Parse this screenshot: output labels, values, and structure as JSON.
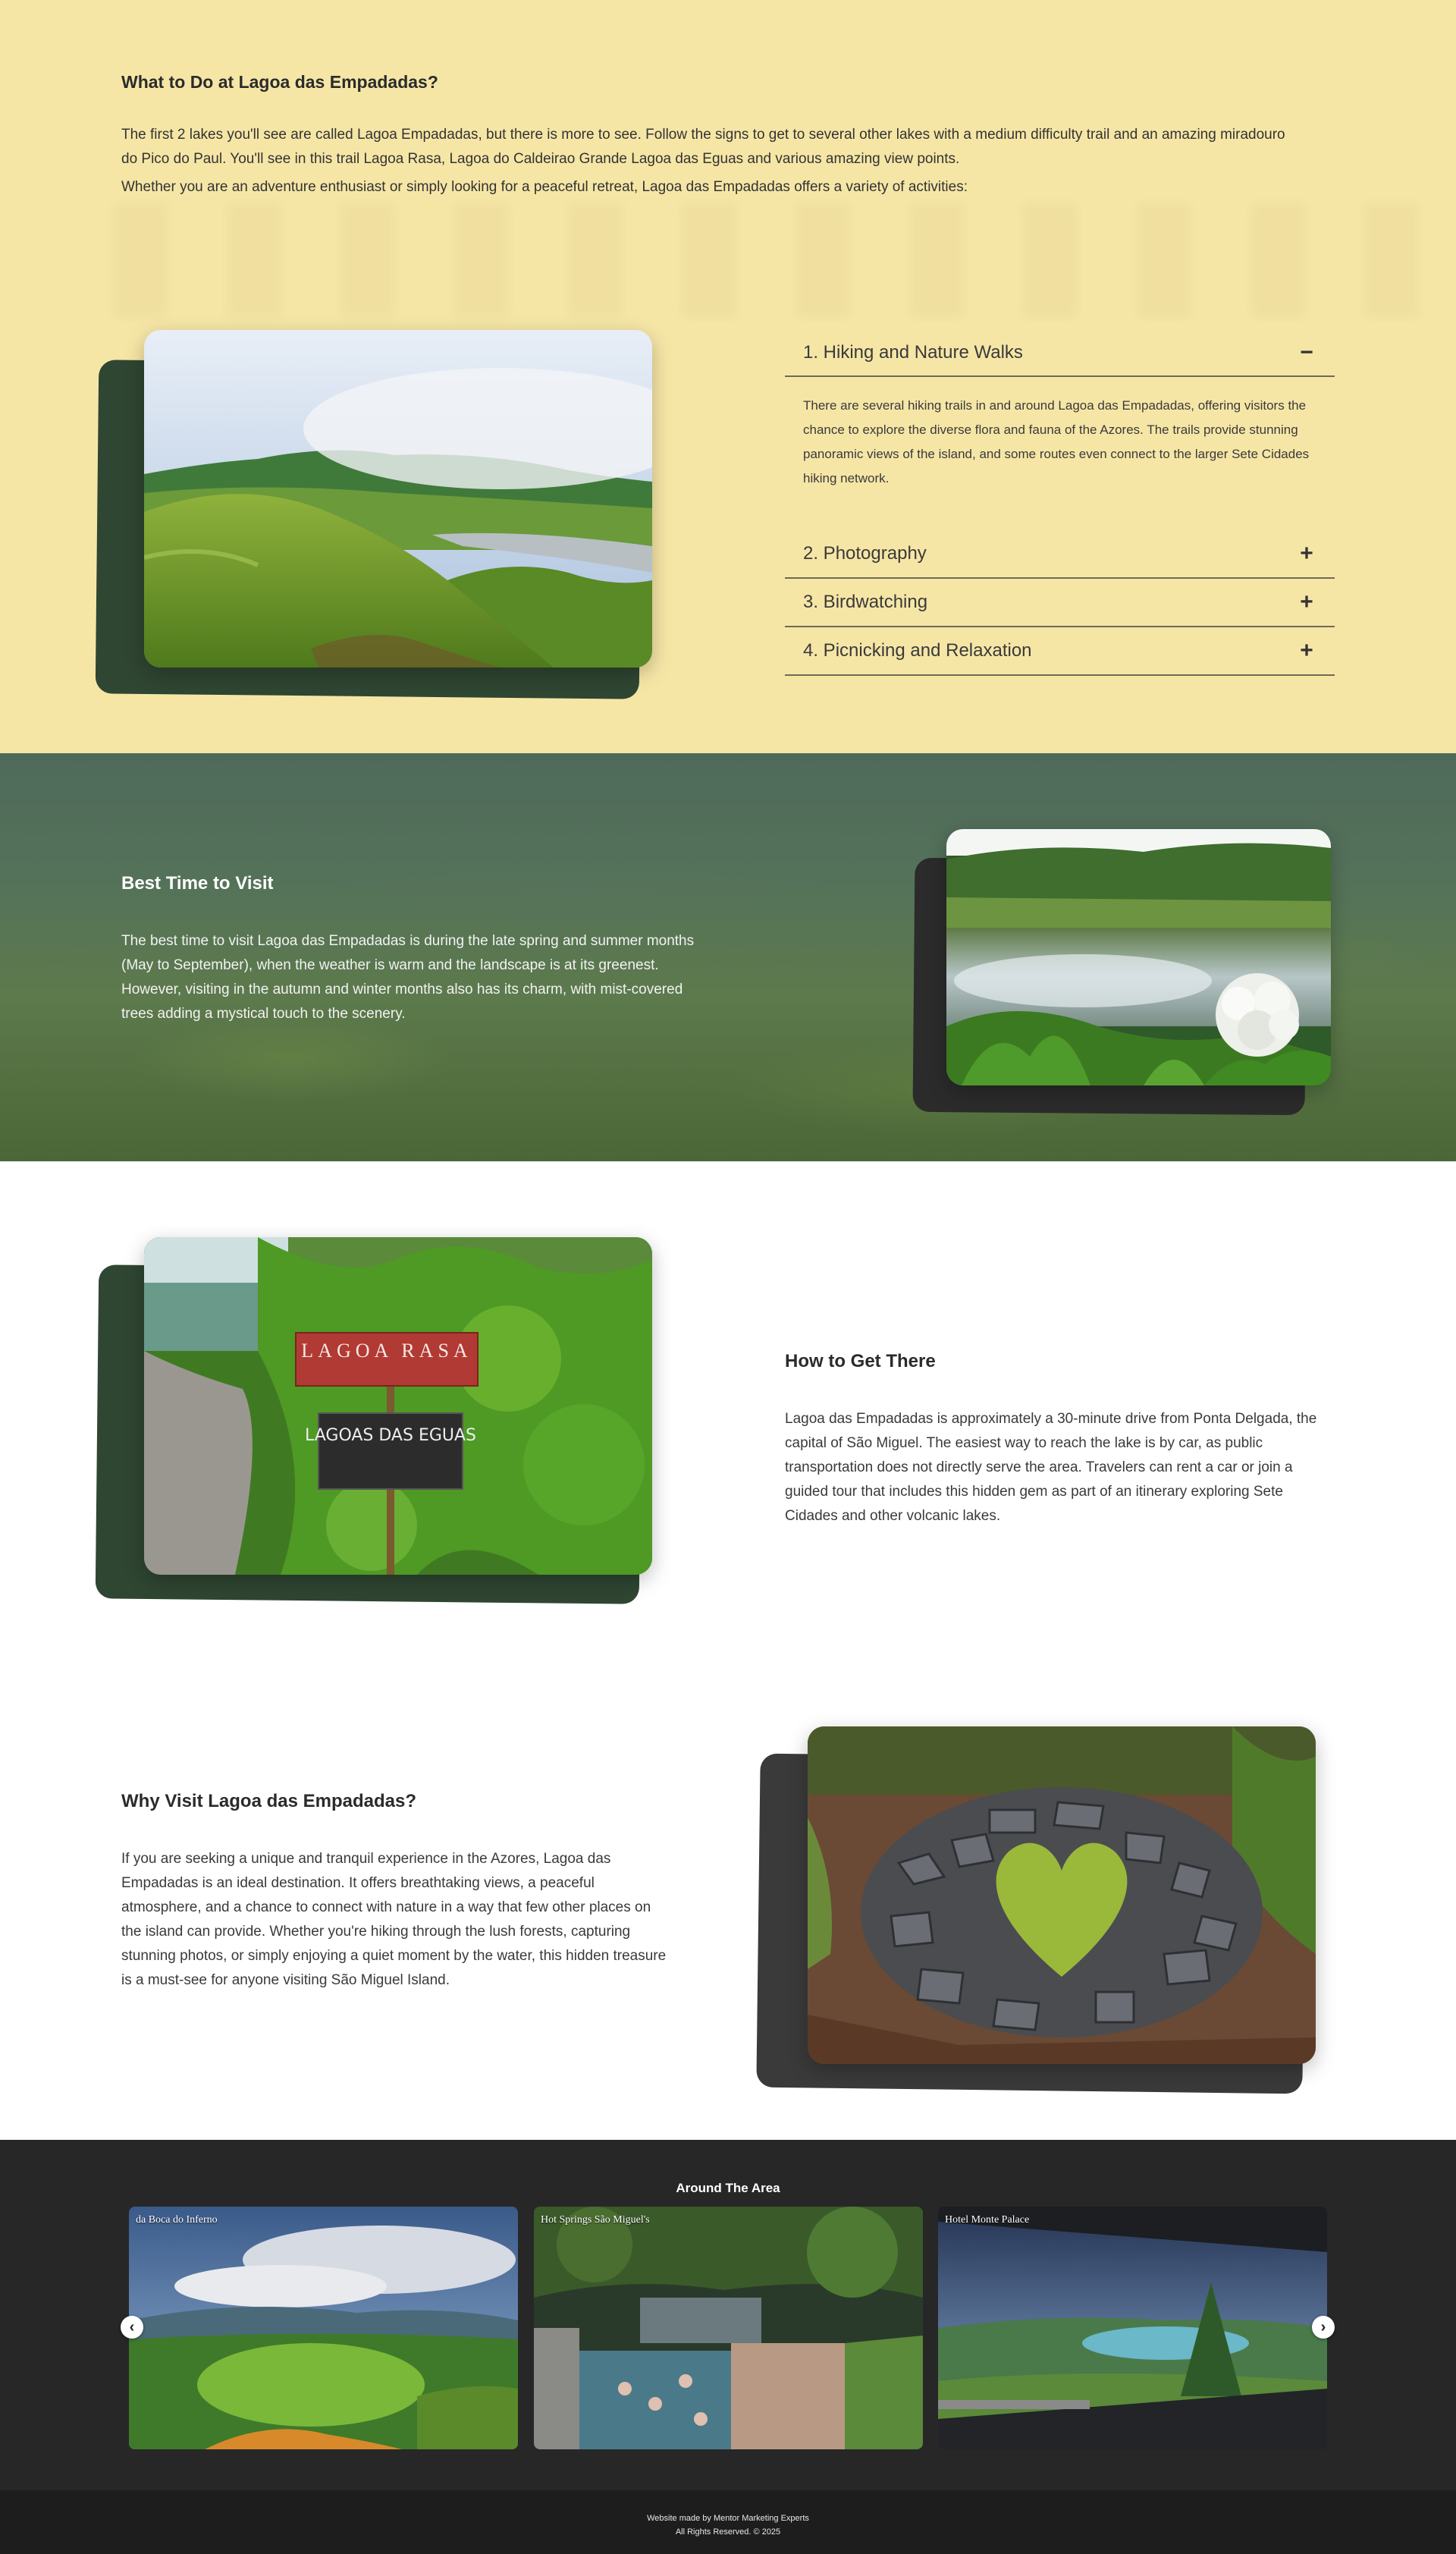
{
  "intro": {
    "title": "What to Do at Lagoa das Empadadas?",
    "p1": "The first 2 lakes you'll see are called Lagoa Empadadas, but there is more to see. Follow the signs to get to several other lakes with a medium difficulty trail and an amazing miradouro do Pico do Paul. You'll see in this trail Lagoa Rasa, Lagoa do Caldeirao Grande Lagoa das Eguas and various amazing view points.",
    "p2": "Whether you are an adventure enthusiast or simply looking for a peaceful retreat, Lagoa das Empadadas offers a variety of activities:"
  },
  "accordion": [
    {
      "title": "1. Hiking and Nature Walks",
      "icon": "minus-icon",
      "symbol": "−",
      "open": true,
      "body": "There are several hiking trails in and around Lagoa das Empadadas, offering visitors the chance to explore the diverse flora and fauna of the Azores. The trails provide stunning panoramic views of the island, and some routes even connect to the larger Sete Cidades hiking network."
    },
    {
      "title": "2. Photography",
      "icon": "plus-icon",
      "symbol": "+",
      "open": false
    },
    {
      "title": "3. Birdwatching",
      "icon": "plus-icon",
      "symbol": "+",
      "open": false
    },
    {
      "title": "4. Picnicking and Relaxation",
      "icon": "plus-icon",
      "symbol": "+",
      "open": false
    }
  ],
  "best_time": {
    "title": "Best Time to Visit",
    "body": "The best time to visit Lagoa das Empadadas is during the late spring and summer months (May to September), when the weather is warm and the landscape is at its greenest. However, visiting in the autumn and winter months also has its charm, with mist-covered trees adding a mystical touch to the scenery."
  },
  "how_to_get": {
    "title": "How to Get There",
    "body": "Lagoa das Empadadas is approximately a 30-minute drive from Ponta Delgada, the capital of São Miguel. The easiest way to reach the lake is by car, as public transportation does not directly serve the area. Travelers can rent a car or join a guided tour that includes this hidden gem as part of an itinerary exploring Sete Cidades and other volcanic lakes.",
    "sign_top": "LAGOA RASA",
    "sign_bottom": "LAGOAS DAS EGUAS"
  },
  "why_visit": {
    "title": "Why Visit Lagoa das Empadadas?",
    "body": "If you are seeking a unique and tranquil experience in the Azores, Lagoa das Empadadas is an ideal destination. It offers breathtaking views, a peaceful atmosphere, and a chance to connect with nature in a way that few other places on the island can provide. Whether you're hiking through the lush forests, capturing stunning photos, or simply enjoying a quiet moment by the water, this hidden treasure is a must-see for anyone visiting São Miguel Island."
  },
  "around": {
    "title": "Around The Area",
    "cards": [
      {
        "caption": "da Boca do Inferno"
      },
      {
        "caption": "Hot Springs São Miguel's"
      },
      {
        "caption": "Hotel Monte Palace"
      }
    ],
    "prev_icon": "‹",
    "next_icon": "›"
  },
  "footer": {
    "line1": "Website made by Mentor Marketing Experts",
    "line2": "All Rights Reserved. © 2025"
  },
  "colors": {
    "yellow_bg": "#f6e6a6",
    "green_shadow": "#2f4632",
    "dark_shadow": "#2b2b2b",
    "footer_bg": "#1d1d1d"
  }
}
